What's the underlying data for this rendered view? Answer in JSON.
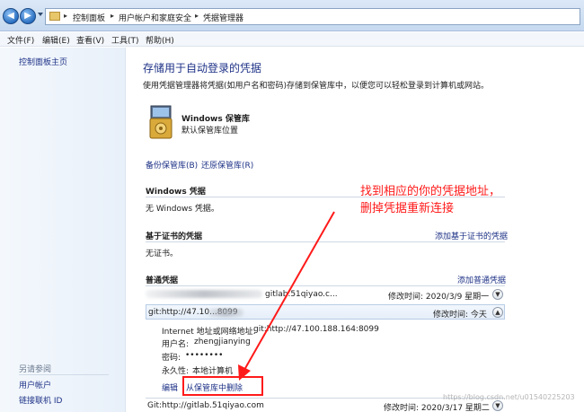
{
  "breadcrumb": [
    "控制面板",
    "用户帐户和家庭安全",
    "凭据管理器"
  ],
  "menu": [
    "文件(F)",
    "编辑(E)",
    "查看(V)",
    "工具(T)",
    "帮助(H)"
  ],
  "sidebar": {
    "home": "控制面板主页",
    "see_also": "另请参阅",
    "links": [
      "用户帐户",
      "链接联机 ID"
    ]
  },
  "main": {
    "title": "存储用于自动登录的凭据",
    "description": "使用凭据管理器将凭据(如用户名和密码)存储到保管库中，以便您可以轻松登录到计算机或网站。",
    "vault_name": "Windows 保管库",
    "vault_sub": "默认保管库位置",
    "backup": "备份保管库(B)",
    "restore": "还原保管库(R)",
    "windows_creds": {
      "heading": "Windows 凭据",
      "empty": "无 Windows 凭据。"
    },
    "cert_creds": {
      "heading": "基于证书的凭据",
      "add": "添加基于证书的凭据",
      "empty": "无证书。"
    },
    "generic_creds": {
      "heading": "普通凭据",
      "add": "添加普通凭据",
      "items": [
        {
          "name": "gitlab.51qiyao.c...",
          "modified": "修改时间:  2020/3/9 星期一"
        },
        {
          "name": "git:http://47.10...8099",
          "modified": "修改时间:  今天"
        },
        {
          "name": "Git:http://gitlab.51qiyao.com",
          "modified": "修改时间:  2020/3/17 星期二"
        }
      ],
      "detail": {
        "address_label": "Internet 地址或网络地址:",
        "address_value": "git:http://47.100.188.164:8099",
        "user_label": "用户名:",
        "user_value": "zhengjianying",
        "pass_label": "密码:",
        "pass_value": "••••••••",
        "persist_label": "永久性:",
        "persist_value": "本地计算机",
        "edit": "编辑",
        "remove": "从保管库中删除"
      }
    }
  },
  "annotation": "找到相应的你的凭据地址，\n删掉凭据重新连接",
  "watermark": "https://blog.csdn.net/u01540225203",
  "colors": {
    "link": "#1e3287",
    "annotation": "#ff1a1a"
  }
}
